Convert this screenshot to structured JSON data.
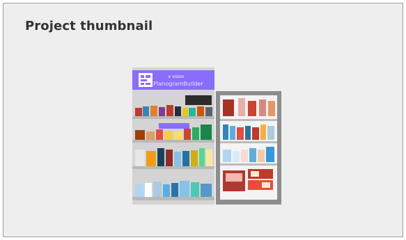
{
  "panel": {
    "title": "Project thumbnail"
  },
  "thumbnail": {
    "banner_line1": "x vision",
    "banner_line2": "PlanogramBuilder",
    "icon": "planogram-logo-icon",
    "colors": {
      "banner": "#8a6cff",
      "banner_text": "#ffffff",
      "shelf_left": "#d4d4d4",
      "shelf_right": "#8d8d8d",
      "shelf_edge": "#b9b9b9"
    }
  }
}
